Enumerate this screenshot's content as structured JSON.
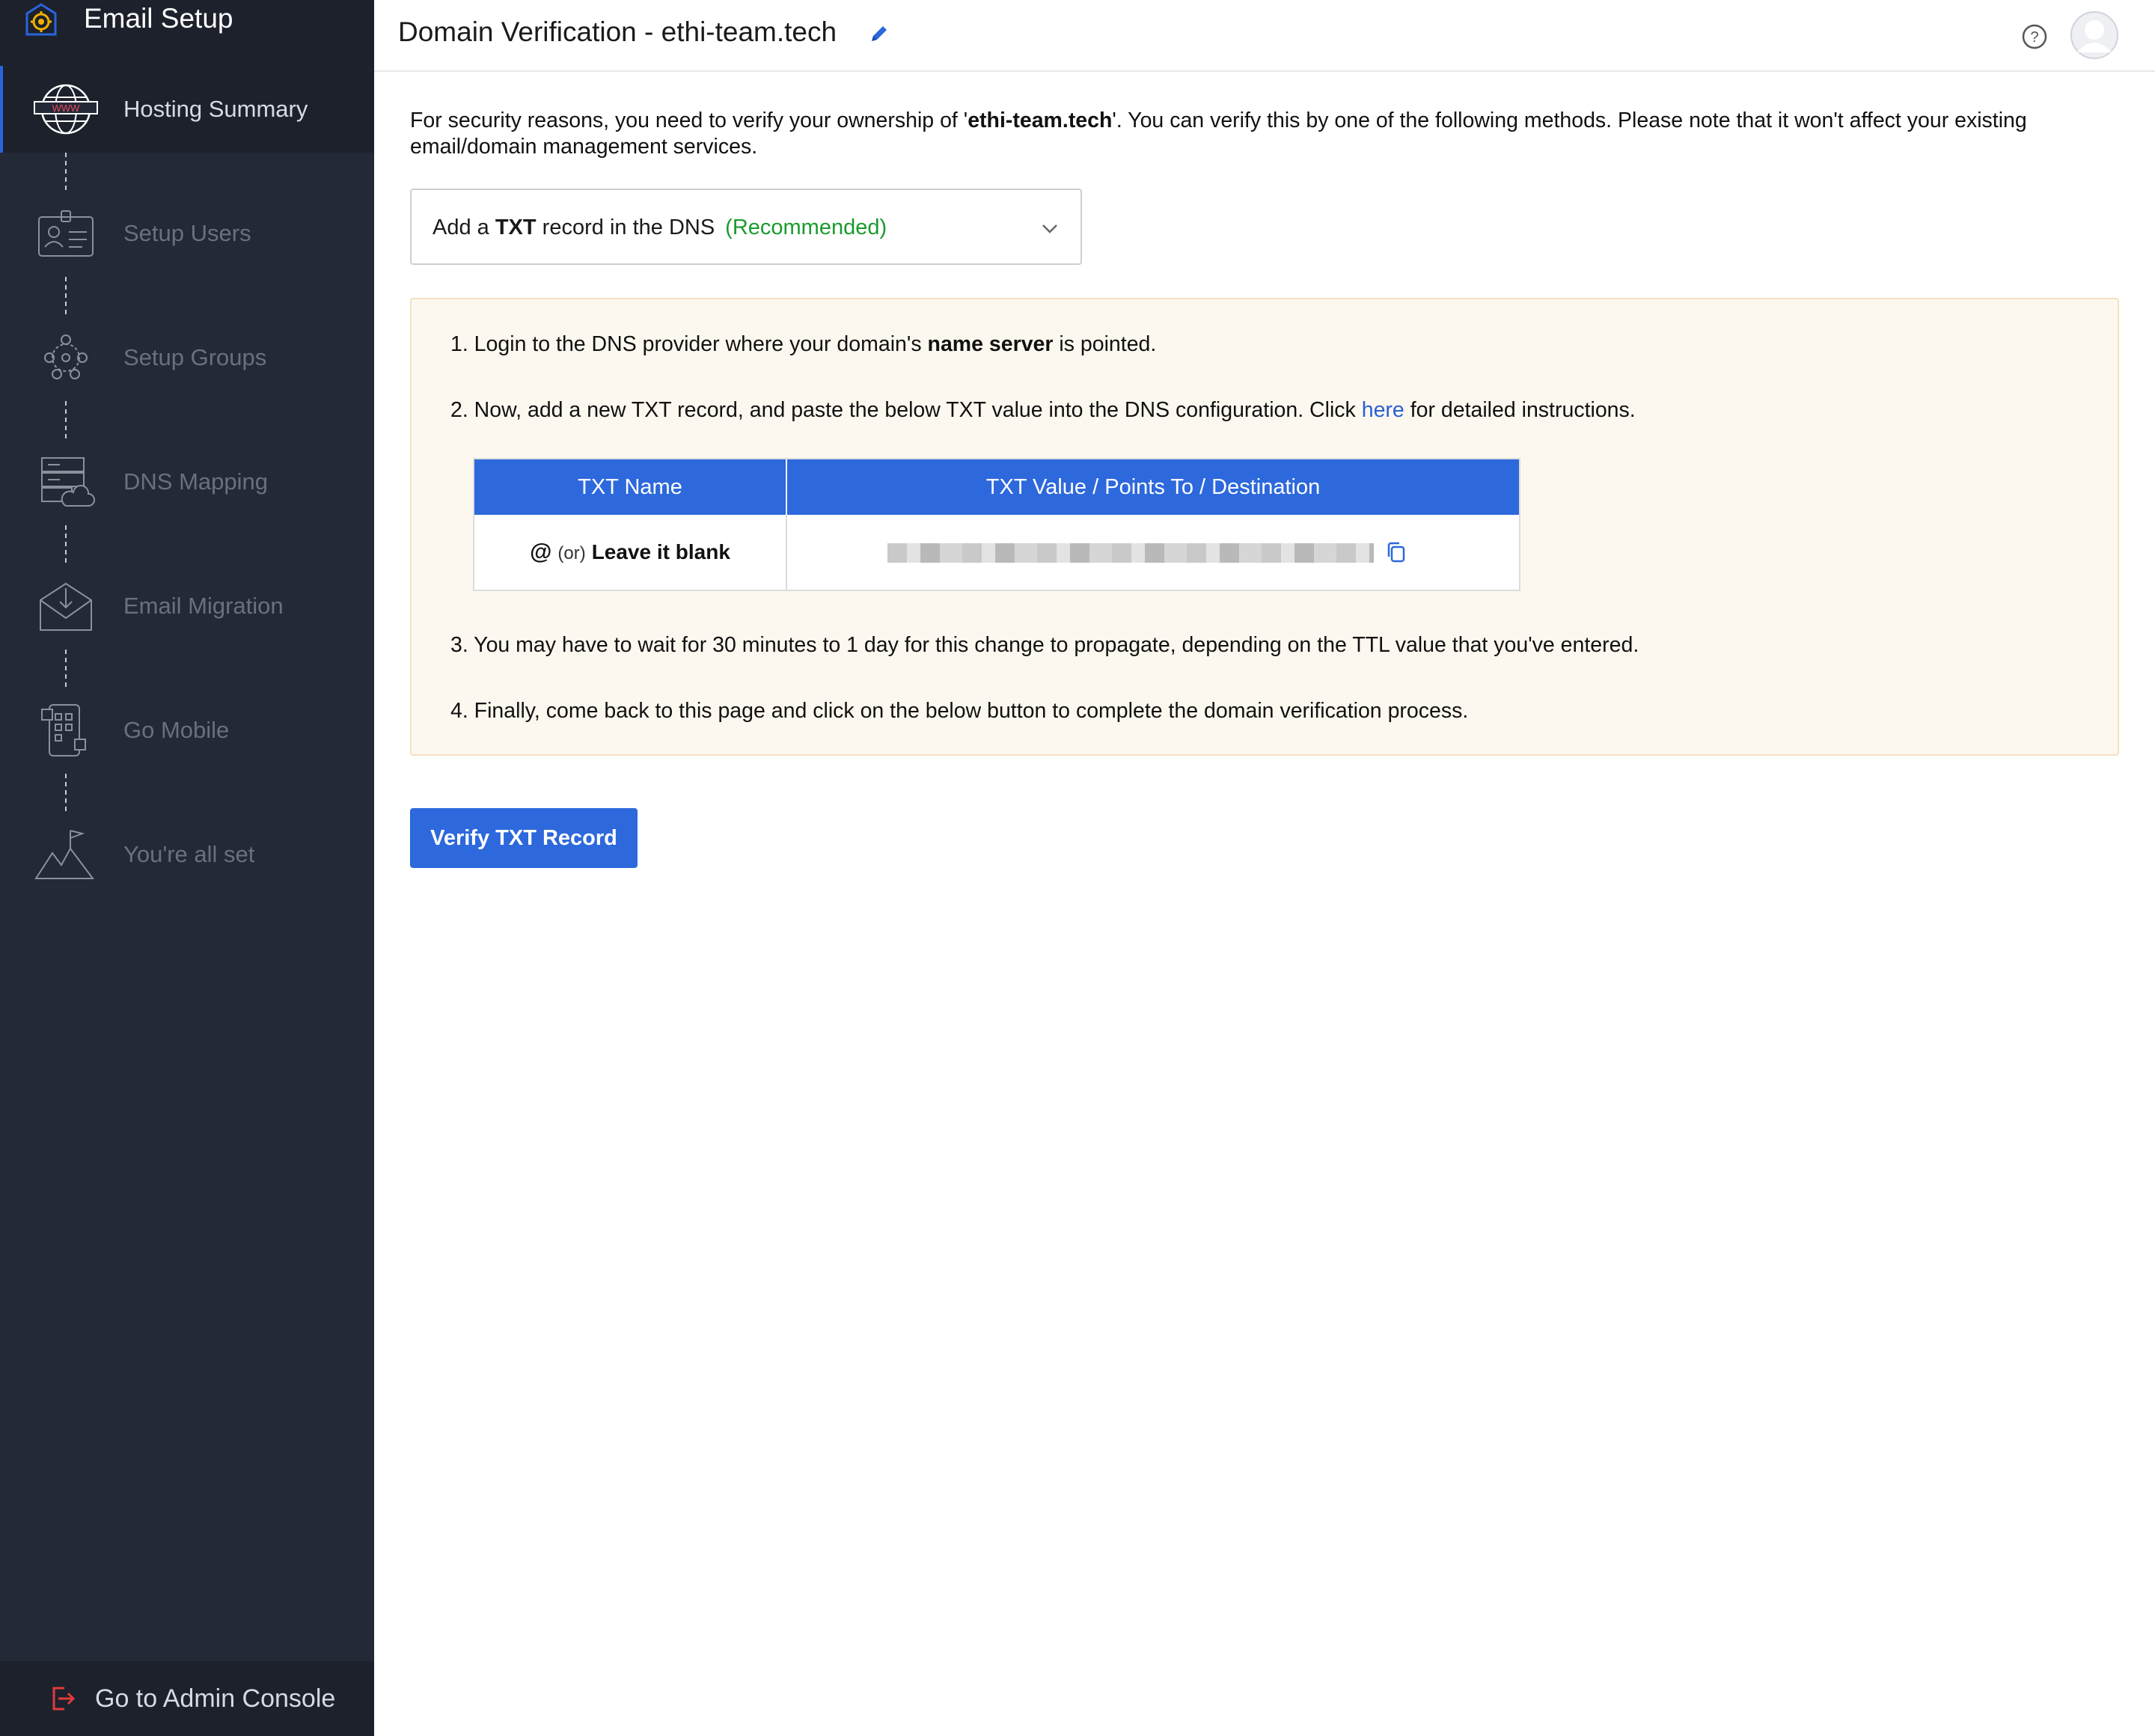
{
  "app": {
    "title": "Email Setup"
  },
  "sidebar": {
    "steps": [
      {
        "label": "Hosting Summary",
        "icon": "globe-www-icon",
        "active": true
      },
      {
        "label": "Setup Users",
        "icon": "user-card-icon",
        "active": false
      },
      {
        "label": "Setup Groups",
        "icon": "group-network-icon",
        "active": false
      },
      {
        "label": "DNS Mapping",
        "icon": "server-cloud-icon",
        "active": false
      },
      {
        "label": "Email Migration",
        "icon": "envelope-download-icon",
        "active": false
      },
      {
        "label": "Go Mobile",
        "icon": "mobile-apps-icon",
        "active": false
      },
      {
        "label": "You're all set",
        "icon": "mountain-flag-icon",
        "active": false
      }
    ],
    "footer_label": "Go to Admin Console"
  },
  "header": {
    "title": "Domain Verification - ethi-team.tech"
  },
  "intro": {
    "prefix": "For security reasons, you need to verify your ownership of '",
    "domain": "ethi-team.tech",
    "suffix": "'. You can verify this by one of the following methods. Please note that it won't affect your existing email/domain management services."
  },
  "method": {
    "prefix": "Add a ",
    "bold": "TXT",
    "suffix": " record in the DNS",
    "tag": "(Recommended)"
  },
  "instructions": {
    "step1_prefix": "1. Login to the DNS provider where your domain's ",
    "step1_bold": "name server",
    "step1_suffix": " is pointed.",
    "step2_prefix": "2. Now, add a new TXT record, and paste the below TXT value into the DNS configuration. Click ",
    "step2_link": "here",
    "step2_suffix": " for detailed instructions.",
    "step3": "3. You may have to wait for 30 minutes to 1 day for this change to propagate, depending on the TTL value that you've entered.",
    "step4": "4. Finally, come back to this page and click on the below button to complete the domain verification process."
  },
  "table": {
    "headers": [
      "TXT Name",
      "TXT Value / Points To / Destination"
    ],
    "name_at": "@",
    "name_or": "(or)",
    "name_blank": "Leave it blank"
  },
  "actions": {
    "verify_label": "Verify TXT Record"
  },
  "colors": {
    "sidebar_bg": "#232937",
    "accent": "#2d68dc",
    "recommended": "#1a9a2e",
    "notice_bg": "#fdf8ef"
  }
}
